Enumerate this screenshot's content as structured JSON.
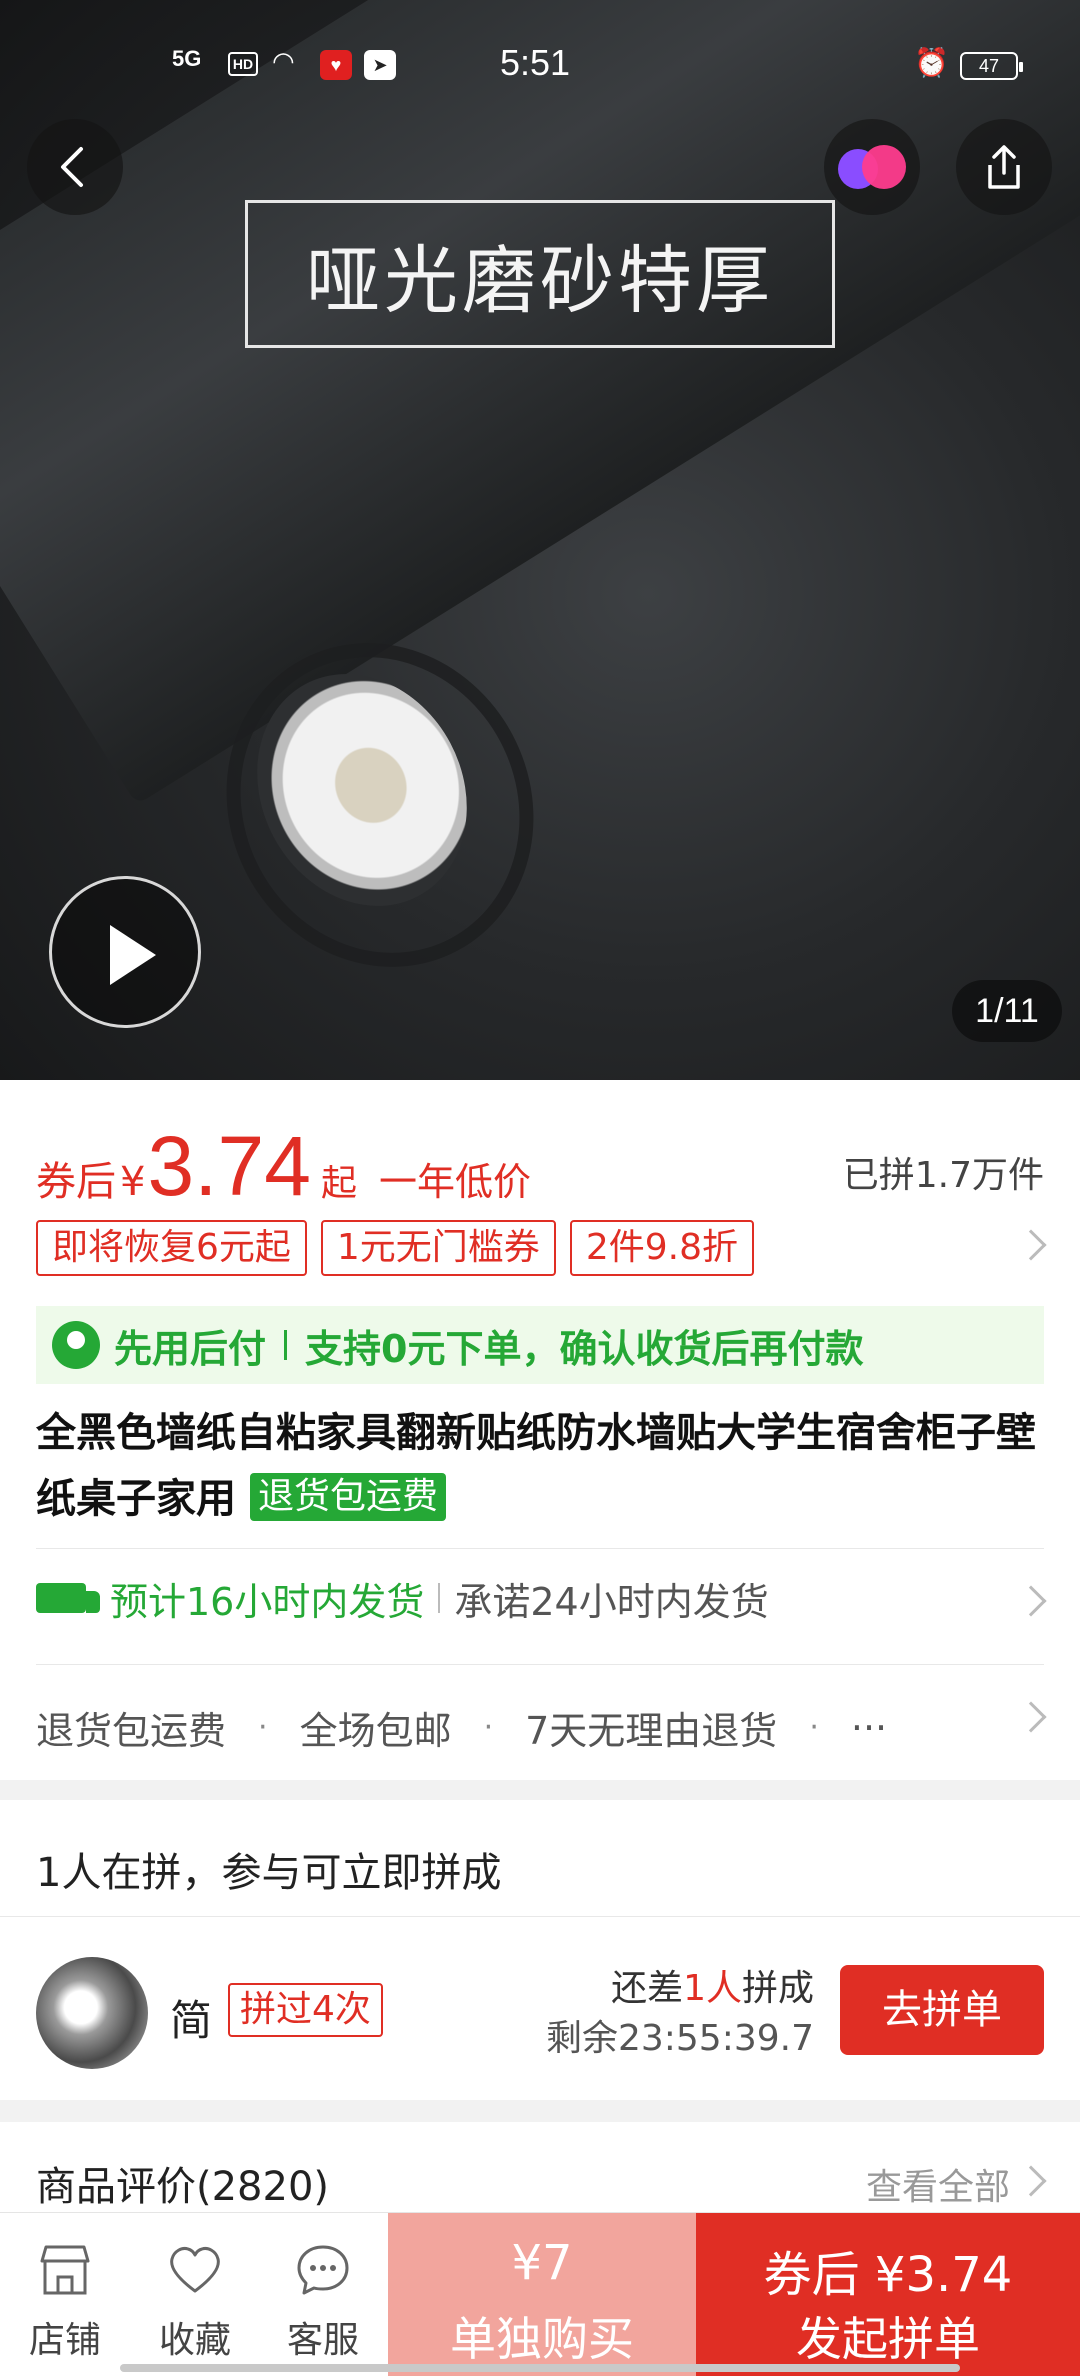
{
  "status_bar": {
    "time": "5:51",
    "network": "5G",
    "hd": "HD",
    "battery": "47"
  },
  "hero": {
    "banner_text": "哑光磨砂特厚",
    "image_counter": "1/11"
  },
  "price": {
    "prefix": "券后",
    "currency": "¥",
    "value": "3.74",
    "suffix": "起",
    "note": "一年低价",
    "sold": "已拼1.7万件"
  },
  "coupons": [
    "即将恢复6元起",
    "1元无门槛券",
    "2件9.8折"
  ],
  "pay_later": {
    "label": "先用后付",
    "text": "支持0元下单，确认收货后再付款"
  },
  "product": {
    "title": "全黑色墙纸自粘家具翻新贴纸防水墙贴大学生宿舍柜子壁纸桌子家用",
    "tag": "退货包运费"
  },
  "shipping": {
    "estimate": "预计16小时内发货",
    "promise": "承诺24小时内发货"
  },
  "services": [
    "退货包运费",
    "全场包邮",
    "7天无理由退货"
  ],
  "services_more": "···",
  "group": {
    "title": "1人在拼，参与可立即拼成",
    "user_name": "简",
    "user_badge": "拼过4次",
    "need_prefix": "还差",
    "need_count": "1人",
    "need_suffix": "拼成",
    "remaining": "剩余23:55:39.7",
    "join_label": "去拼单"
  },
  "reviews": {
    "title": "商品评价(2820)",
    "view_all": "查看全部"
  },
  "bottom_bar": {
    "store": "店铺",
    "favorite": "收藏",
    "service": "客服",
    "single_price": "¥7",
    "single_label": "单独购买",
    "group_price": "券后 ¥3.74",
    "group_label": "发起拼单"
  },
  "colors": {
    "accent_red": "#e02e24",
    "accent_green": "#25a836",
    "single_button": "#f2a59d"
  }
}
